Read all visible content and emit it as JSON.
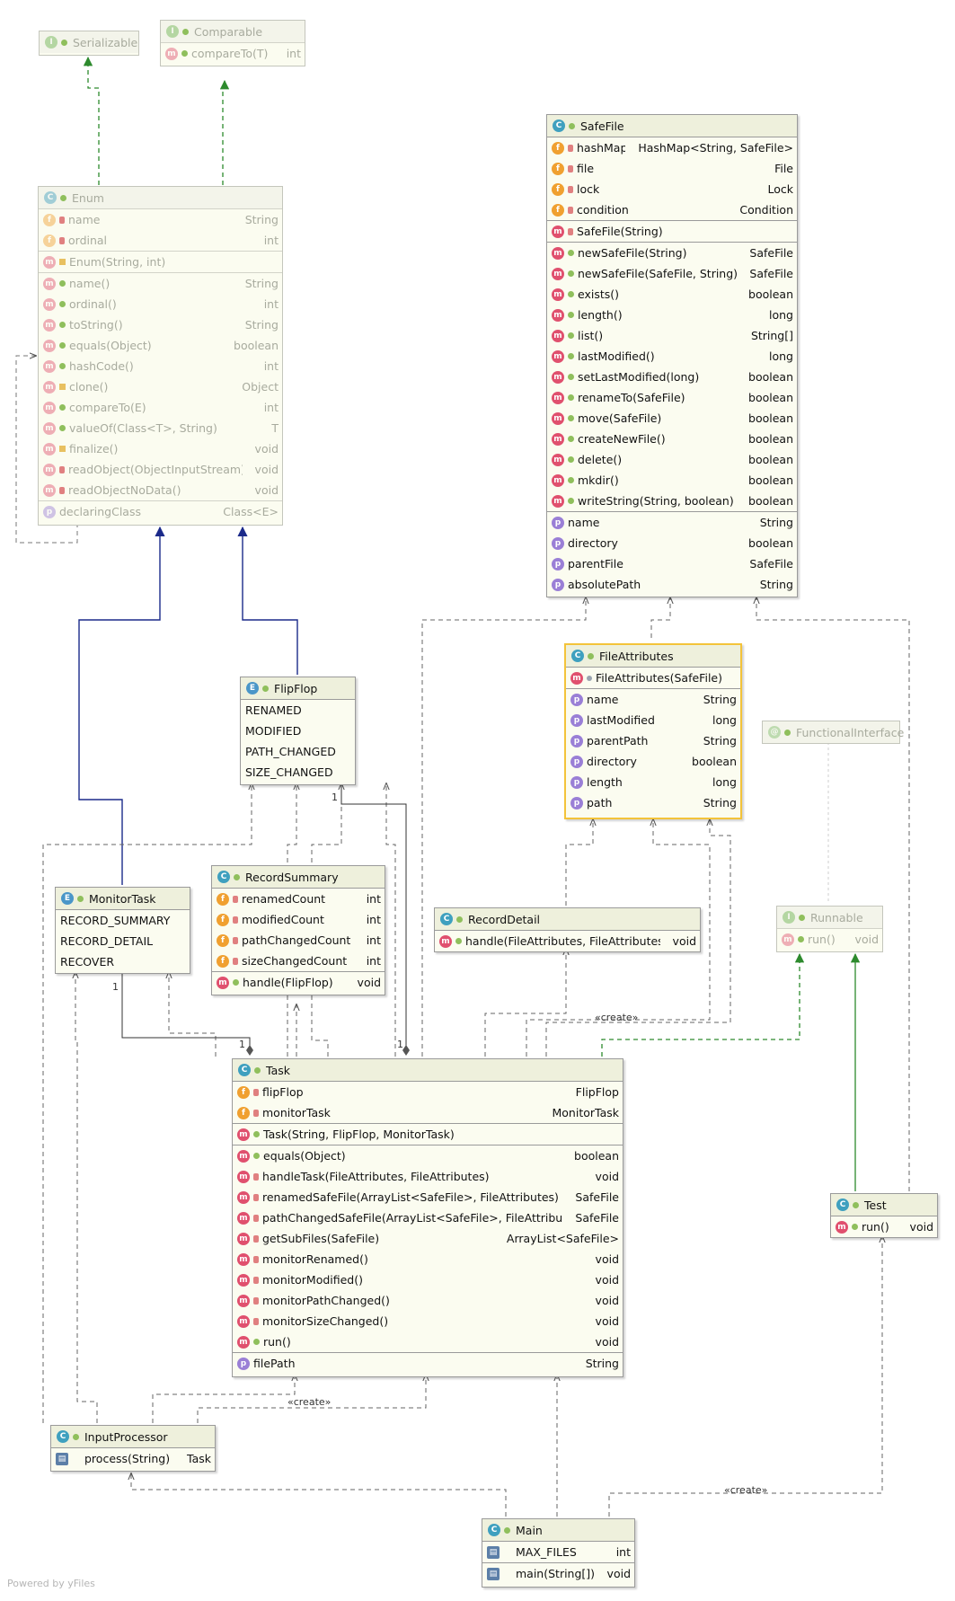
{
  "footer": "Powered by yFiles",
  "labels": {
    "create": "«create»",
    "one": "1"
  },
  "serializable": {
    "title": "Serializable"
  },
  "comparable": {
    "title": "Comparable",
    "methods": [
      {
        "name": "compareTo(T)",
        "type": "int"
      }
    ]
  },
  "enum": {
    "title": "Enum",
    "fields": [
      {
        "name": "name",
        "type": "String"
      },
      {
        "name": "ordinal",
        "type": "int"
      }
    ],
    "constructors": [
      {
        "name": "Enum(String, int)",
        "type": ""
      }
    ],
    "methods": [
      {
        "name": "name()",
        "type": "String"
      },
      {
        "name": "ordinal()",
        "type": "int"
      },
      {
        "name": "toString()",
        "type": "String"
      },
      {
        "name": "equals(Object)",
        "type": "boolean"
      },
      {
        "name": "hashCode()",
        "type": "int"
      },
      {
        "name": "clone()",
        "type": "Object"
      },
      {
        "name": "compareTo(E)",
        "type": "int"
      },
      {
        "name": "valueOf(Class<T>, String)",
        "type": "T"
      },
      {
        "name": "finalize()",
        "type": "void"
      },
      {
        "name": "readObject(ObjectInputStream)",
        "type": "void"
      },
      {
        "name": "readObjectNoData()",
        "type": "void"
      }
    ],
    "properties": [
      {
        "name": "declaringClass",
        "type": "Class<E>"
      }
    ]
  },
  "safefile": {
    "title": "SafeFile",
    "fields": [
      {
        "name": "hashMap",
        "type": "HashMap<String, SafeFile>"
      },
      {
        "name": "file",
        "type": "File"
      },
      {
        "name": "lock",
        "type": "Lock"
      },
      {
        "name": "condition",
        "type": "Condition"
      }
    ],
    "constructors": [
      {
        "name": "SafeFile(String)",
        "type": ""
      }
    ],
    "methods": [
      {
        "name": "newSafeFile(String)",
        "type": "SafeFile"
      },
      {
        "name": "newSafeFile(SafeFile, String)",
        "type": "SafeFile"
      },
      {
        "name": "exists()",
        "type": "boolean"
      },
      {
        "name": "length()",
        "type": "long"
      },
      {
        "name": "list()",
        "type": "String[]"
      },
      {
        "name": "lastModified()",
        "type": "long"
      },
      {
        "name": "setLastModified(long)",
        "type": "boolean"
      },
      {
        "name": "renameTo(SafeFile)",
        "type": "boolean"
      },
      {
        "name": "move(SafeFile)",
        "type": "boolean"
      },
      {
        "name": "createNewFile()",
        "type": "boolean"
      },
      {
        "name": "delete()",
        "type": "boolean"
      },
      {
        "name": "mkdir()",
        "type": "boolean"
      },
      {
        "name": "writeString(String, boolean)",
        "type": "boolean"
      }
    ],
    "properties": [
      {
        "name": "name",
        "type": "String"
      },
      {
        "name": "directory",
        "type": "boolean"
      },
      {
        "name": "parentFile",
        "type": "SafeFile"
      },
      {
        "name": "absolutePath",
        "type": "String"
      }
    ]
  },
  "fileattributes": {
    "title": "FileAttributes",
    "constructors": [
      {
        "name": "FileAttributes(SafeFile)",
        "type": ""
      }
    ],
    "properties": [
      {
        "name": "name",
        "type": "String"
      },
      {
        "name": "lastModified",
        "type": "long"
      },
      {
        "name": "parentPath",
        "type": "String"
      },
      {
        "name": "directory",
        "type": "boolean"
      },
      {
        "name": "length",
        "type": "long"
      },
      {
        "name": "path",
        "type": "String"
      }
    ]
  },
  "functionalinterface": {
    "title": "FunctionalInterface"
  },
  "flipflop": {
    "title": "FlipFlop",
    "constants": [
      "RENAMED",
      "MODIFIED",
      "PATH_CHANGED",
      "SIZE_CHANGED"
    ]
  },
  "monitortask": {
    "title": "MonitorTask",
    "constants": [
      "RECORD_SUMMARY",
      "RECORD_DETAIL",
      "RECOVER"
    ]
  },
  "recordsummary": {
    "title": "RecordSummary",
    "fields": [
      {
        "name": "renamedCount",
        "type": "int"
      },
      {
        "name": "modifiedCount",
        "type": "int"
      },
      {
        "name": "pathChangedCount",
        "type": "int"
      },
      {
        "name": "sizeChangedCount",
        "type": "int"
      }
    ],
    "methods": [
      {
        "name": "handle(FlipFlop)",
        "type": "void"
      }
    ]
  },
  "recorddetail": {
    "title": "RecordDetail",
    "methods": [
      {
        "name": "handle(FileAttributes, FileAttributes)",
        "type": "void"
      }
    ]
  },
  "runnable": {
    "title": "Runnable",
    "methods": [
      {
        "name": "run()",
        "type": "void"
      }
    ]
  },
  "task": {
    "title": "Task",
    "fields": [
      {
        "name": "flipFlop",
        "type": "FlipFlop"
      },
      {
        "name": "monitorTask",
        "type": "MonitorTask"
      }
    ],
    "constructors": [
      {
        "name": "Task(String, FlipFlop, MonitorTask)",
        "type": ""
      }
    ],
    "methods": [
      {
        "name": "equals(Object)",
        "type": "boolean"
      },
      {
        "name": "handleTask(FileAttributes, FileAttributes)",
        "type": "void"
      },
      {
        "name": "renamedSafeFile(ArrayList<SafeFile>, FileAttributes)",
        "type": "SafeFile"
      },
      {
        "name": "pathChangedSafeFile(ArrayList<SafeFile>, FileAttributes)",
        "type": "SafeFile"
      },
      {
        "name": "getSubFiles(SafeFile)",
        "type": "ArrayList<SafeFile>"
      },
      {
        "name": "monitorRenamed()",
        "type": "void"
      },
      {
        "name": "monitorModified()",
        "type": "void"
      },
      {
        "name": "monitorPathChanged()",
        "type": "void"
      },
      {
        "name": "monitorSizeChanged()",
        "type": "void"
      },
      {
        "name": "run()",
        "type": "void"
      }
    ],
    "properties": [
      {
        "name": "filePath",
        "type": "String"
      }
    ]
  },
  "test": {
    "title": "Test",
    "methods": [
      {
        "name": "run()",
        "type": "void"
      }
    ]
  },
  "inputprocessor": {
    "title": "InputProcessor",
    "methods": [
      {
        "name": "process(String)",
        "type": "Task"
      }
    ]
  },
  "main": {
    "title": "Main",
    "fields": [
      {
        "name": "MAX_FILES",
        "type": "int"
      }
    ],
    "methods": [
      {
        "name": "main(String[])",
        "type": "void"
      }
    ]
  }
}
